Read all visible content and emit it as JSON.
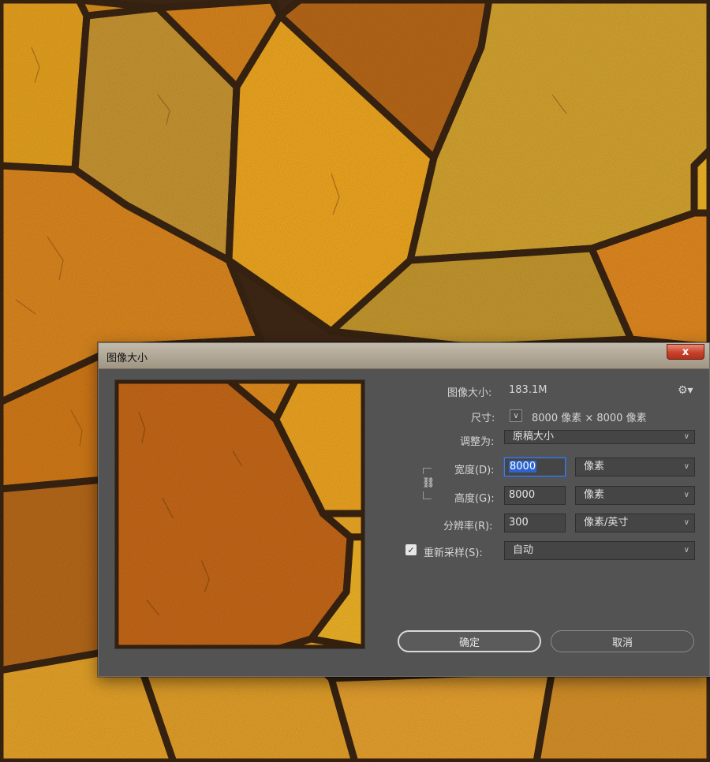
{
  "dialog": {
    "title": "图像大小",
    "close_label": "x"
  },
  "info": {
    "image_size_label": "图像大小:",
    "image_size_value": "183.1M",
    "dimensions_label": "尺寸:",
    "dimensions_value": "8000 像素  ×  8000 像素"
  },
  "fit": {
    "label": "调整为:",
    "value": "原稿大小"
  },
  "width": {
    "label": "宽度(D):",
    "value": "8000",
    "unit": "像素"
  },
  "height": {
    "label": "高度(G):",
    "value": "8000",
    "unit": "像素"
  },
  "resolution": {
    "label": "分辨率(R):",
    "value": "300",
    "unit": "像素/英寸"
  },
  "resample": {
    "label": "重新采样(S):",
    "checked": true,
    "value": "自动"
  },
  "buttons": {
    "ok": "确定",
    "cancel": "取消"
  },
  "icons": {
    "gear": "gear-icon",
    "link": "link-icon",
    "chevron": "chevron-down-icon",
    "check": "checkmark-icon",
    "close": "close-icon"
  },
  "colors": {
    "dialog_bg": "#535353",
    "selection_blue": "#2b64d1",
    "close_red": "#c8412b"
  }
}
